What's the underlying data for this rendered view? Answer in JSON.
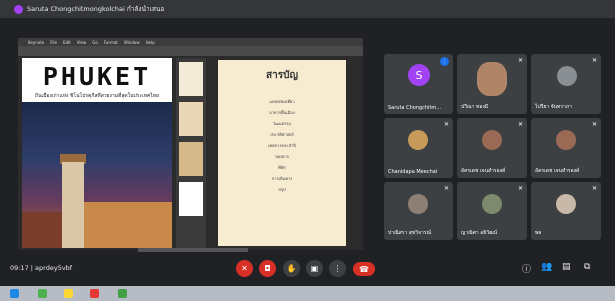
{
  "meeting": {
    "title": "Saruta Chongchitmongkolchai กำลังนำเสนอ",
    "code_line": "09:17 | aprdey5vbf"
  },
  "presentation": {
    "app_menu": [
      "Keynote",
      "File",
      "Edit",
      "View",
      "Go",
      "Format",
      "Window",
      "Help"
    ],
    "slide_left": {
      "title": "PHUKET",
      "subtitle": "ถิ่นเมืองเก่าแห่ง ชิโนโปรตุกีสที่สวยงามที่สุดในประเทศไทย"
    },
    "slide_right": {
      "title": "สารบัญ",
      "items": [
        "แหล่งท่องเที่ยว",
        "อาหารพื้นเมือง",
        "วัฒนธรรม",
        "ประวัติศาสตร์",
        "เทศกาลประจำปี",
        "ของฝาก",
        "ที่พัก",
        "การเดินทาง",
        "สรุป"
      ]
    }
  },
  "participants": [
    {
      "name": "Saruta Chongchitm...",
      "kind": "letter-avatar",
      "letter": "S",
      "color": "#a142f4"
    },
    {
      "name": "ปวีณา ทองมี",
      "kind": "camera"
    },
    {
      "name": "ไปรียา จันทราภา",
      "kind": "photo"
    },
    {
      "name": "Chanidapa Meechai",
      "kind": "photo"
    },
    {
      "name": "อัครเดช เจนสำรองค์",
      "kind": "photo"
    },
    {
      "name": "อัครเดช เจนสำรองค์",
      "kind": "photo"
    },
    {
      "name": "ปาณิสรา สุขวิจารณ์",
      "kind": "photo"
    },
    {
      "name": "ญาณิศา อธิวัฒน์",
      "kind": "photo"
    },
    {
      "name": "พล",
      "kind": "photo"
    }
  ],
  "controls": {
    "mic": "mic-off-icon",
    "camera": "camera-off-icon",
    "hand": "raise-hand-icon",
    "present": "present-icon",
    "more": "more-vert-icon",
    "end": "end-call-icon"
  },
  "colors": {
    "danger": "#d93025",
    "surface": "#3c4043",
    "background": "#202124"
  }
}
